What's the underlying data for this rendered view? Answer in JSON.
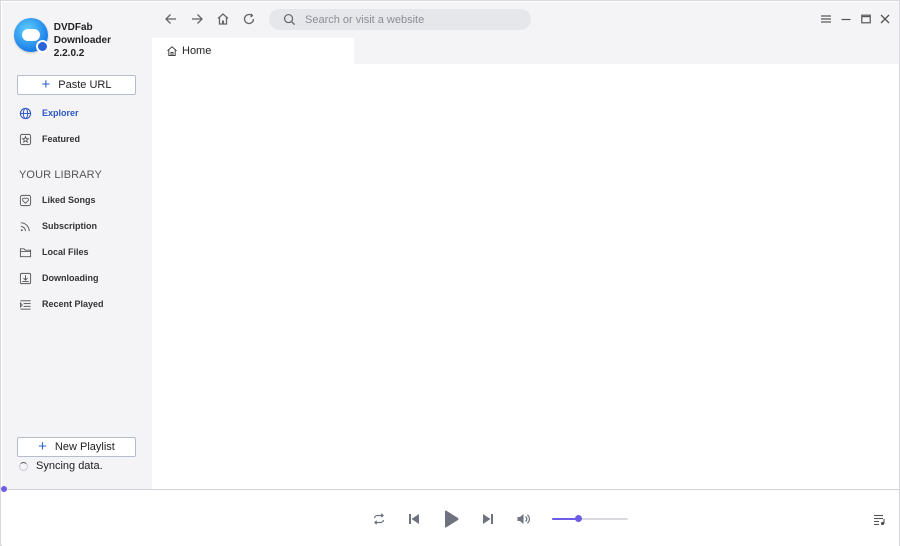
{
  "app": {
    "name": "DVDFab Downloader",
    "version": "2.2.0.2"
  },
  "sidebar": {
    "paste_url_label": "Paste URL",
    "nav": [
      {
        "label": "Explorer",
        "icon": "globe-icon",
        "active": true
      },
      {
        "label": "Featured",
        "icon": "star-icon",
        "active": false
      }
    ],
    "library_title": "YOUR LIBRARY",
    "library": [
      {
        "label": "Liked Songs",
        "icon": "heart-icon"
      },
      {
        "label": "Subscription",
        "icon": "rss-icon"
      },
      {
        "label": "Local Files",
        "icon": "folder-icon"
      },
      {
        "label": "Downloading",
        "icon": "download-icon"
      },
      {
        "label": "Recent Played",
        "icon": "history-list-icon"
      }
    ],
    "new_playlist_label": "New Playlist",
    "sync_status": "Syncing data."
  },
  "toolbar": {
    "search_placeholder": "Search or visit a website",
    "search_value": ""
  },
  "tabs": [
    {
      "label": "Home",
      "icon": "home-icon"
    }
  ],
  "player": {
    "progress": 0.0,
    "volume": 0.35
  },
  "colors": {
    "accent": "#6d5ce8",
    "active_nav": "#2a56c6",
    "sidebar_bg": "#f4f4f6"
  }
}
